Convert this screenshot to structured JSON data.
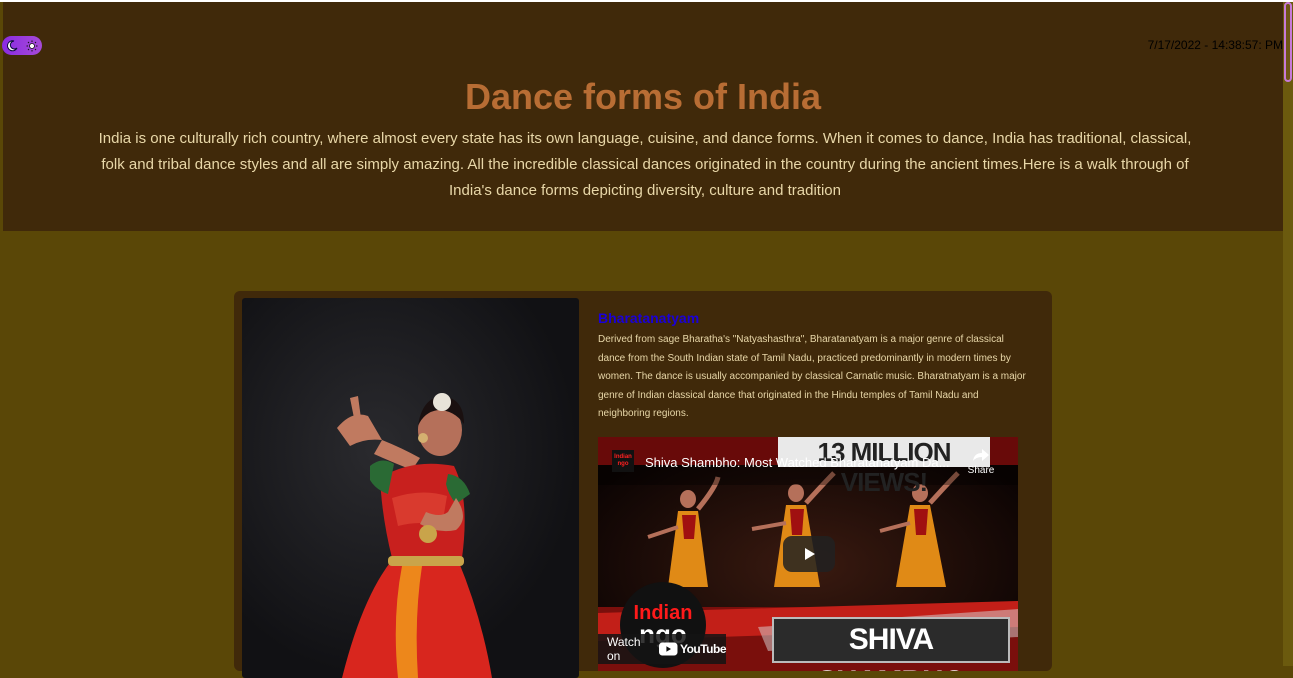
{
  "header": {
    "datetime": "7/17/2022 - 14:38:57: PM",
    "title": "Dance forms of India",
    "intro": "India is one culturally rich country, where almost every state has its own language, cuisine, and dance forms. When it comes to dance, India has traditional, classical, folk and tribal dance styles and all are simply amazing. All the incredible classical dances originated in the country during the ancient times.Here is a walk through of India's dance forms depicting diversity, culture and tradition"
  },
  "theme_toggle": {
    "icons": [
      "moon-icon",
      "sun-icon"
    ]
  },
  "card": {
    "title": "Bharatanatyam",
    "description": "Derived from sage Bharatha's \"Natyashasthra\", Bharatanatyam is a major genre of classical dance from the South Indian state of Tamil Nadu, practiced predominantly in modern times by women. The dance is usually accompanied by classical Carnatic music. Bharatnatyam is a major genre of Indian classical dance that originated in the Hindu temples of Tamil Nadu and neighboring regions.",
    "video": {
      "channel_logo_text": "Indian ngo",
      "title": "Shiva Shambho: Most Watched Bharatanatyam  Da...",
      "share_label": "Share",
      "banner_top": "13 MILLION VIEWS!",
      "banner_bottom": "SHIVA SHAMBHO",
      "logo_line1": "Indian",
      "logo_line2": "ngo",
      "watch_on": "Watch on",
      "youtube": "YouTube"
    }
  },
  "colors": {
    "page_bg": "#5a4707",
    "header_bg": "#40290a",
    "title": "#b86d34",
    "card_title": "#1a00d8",
    "text": "#e8d7a8"
  }
}
